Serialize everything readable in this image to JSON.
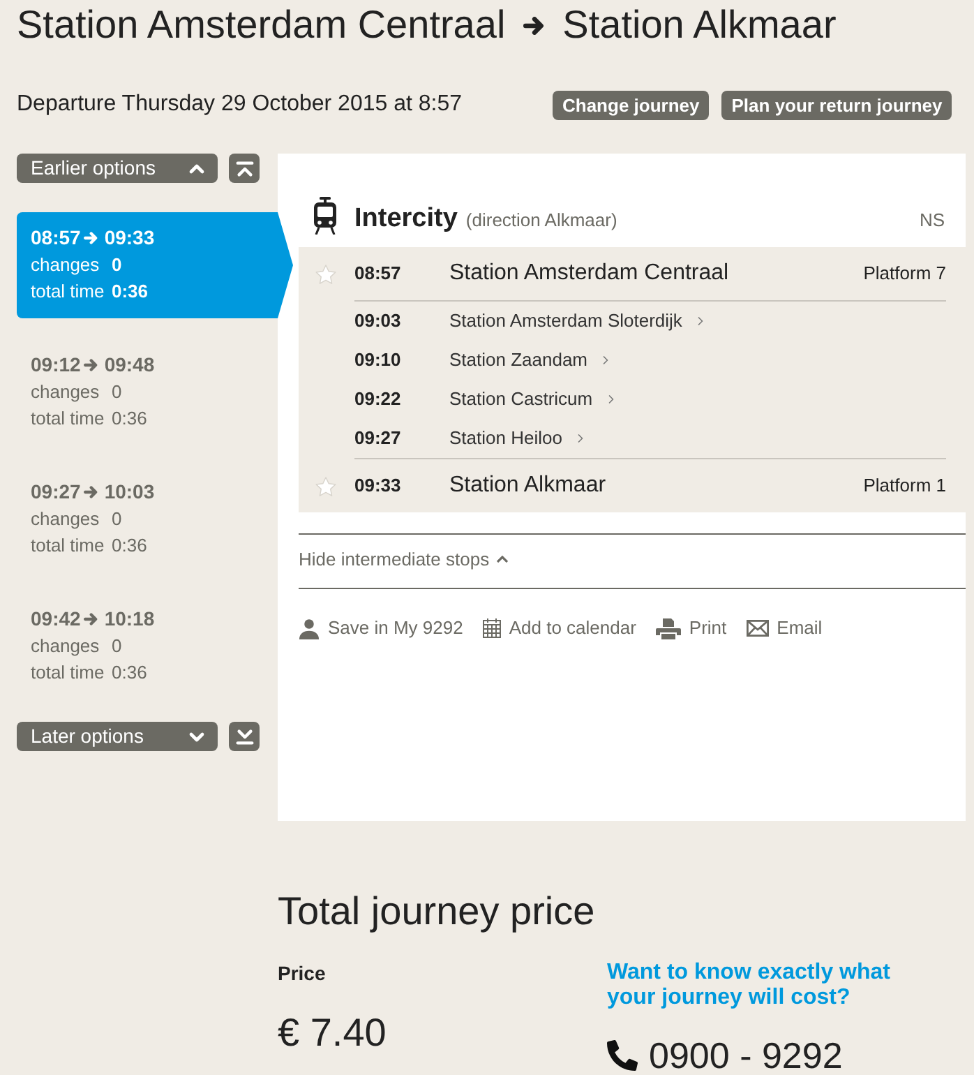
{
  "header": {
    "from": "Station Amsterdam Centraal",
    "to": "Station Alkmaar",
    "departure": "Departure Thursday 29 October 2015 at 8:57",
    "buttons": [
      "Change journey",
      "Plan your return journey"
    ]
  },
  "earlier_options": {
    "label": "Earlier options"
  },
  "options": [
    {
      "departure": "08:57",
      "arrival": "09:33",
      "changes_label": "changes",
      "changes": "0",
      "total_time_label": "total time",
      "total_time": "0:36",
      "selected": true
    },
    {
      "departure": "09:12",
      "arrival": "09:48",
      "changes_label": "changes",
      "changes": "0",
      "total_time_label": "total time",
      "total_time": "0:36",
      "selected": false
    },
    {
      "departure": "09:27",
      "arrival": "10:03",
      "changes_label": "changes",
      "changes": "0",
      "total_time_label": "total time",
      "total_time": "0:36",
      "selected": false
    },
    {
      "departure": "09:42",
      "arrival": "10:18",
      "changes_label": "changes",
      "changes": "0",
      "total_time_label": "total time",
      "total_time": "0:36",
      "selected": false
    }
  ],
  "later_options": {
    "label": "Later options"
  },
  "leg": {
    "train": "Intercity",
    "direction": "(direction Alkmaar)",
    "operator": "NS",
    "stops": [
      {
        "kind": "endpoint",
        "time": "08:57",
        "station": "Station Amsterdam Centraal",
        "platform": "Platform 7"
      },
      {
        "kind": "intermediate",
        "time": "09:03",
        "station": "Station Amsterdam Sloterdijk"
      },
      {
        "kind": "intermediate",
        "time": "09:10",
        "station": "Station Zaandam"
      },
      {
        "kind": "intermediate",
        "time": "09:22",
        "station": "Station Castricum"
      },
      {
        "kind": "intermediate",
        "time": "09:27",
        "station": "Station Heiloo"
      },
      {
        "kind": "endpoint",
        "time": "09:33",
        "station": "Station Alkmaar",
        "platform": "Platform 1"
      }
    ]
  },
  "stops_toggle": {
    "label": "Hide intermediate stops",
    "expanded": true
  },
  "actions": [
    {
      "kind": "save",
      "label": "Save in My 9292"
    },
    {
      "kind": "calendar",
      "label": "Add to calendar"
    },
    {
      "kind": "print",
      "label": "Print"
    },
    {
      "kind": "email",
      "label": "Email"
    }
  ],
  "price": {
    "title": "Total journey price",
    "label": "Price",
    "amount": "€ 7.40",
    "info": "Want to know exactly what your journey will cost?",
    "phone": "0900 - 9292"
  }
}
